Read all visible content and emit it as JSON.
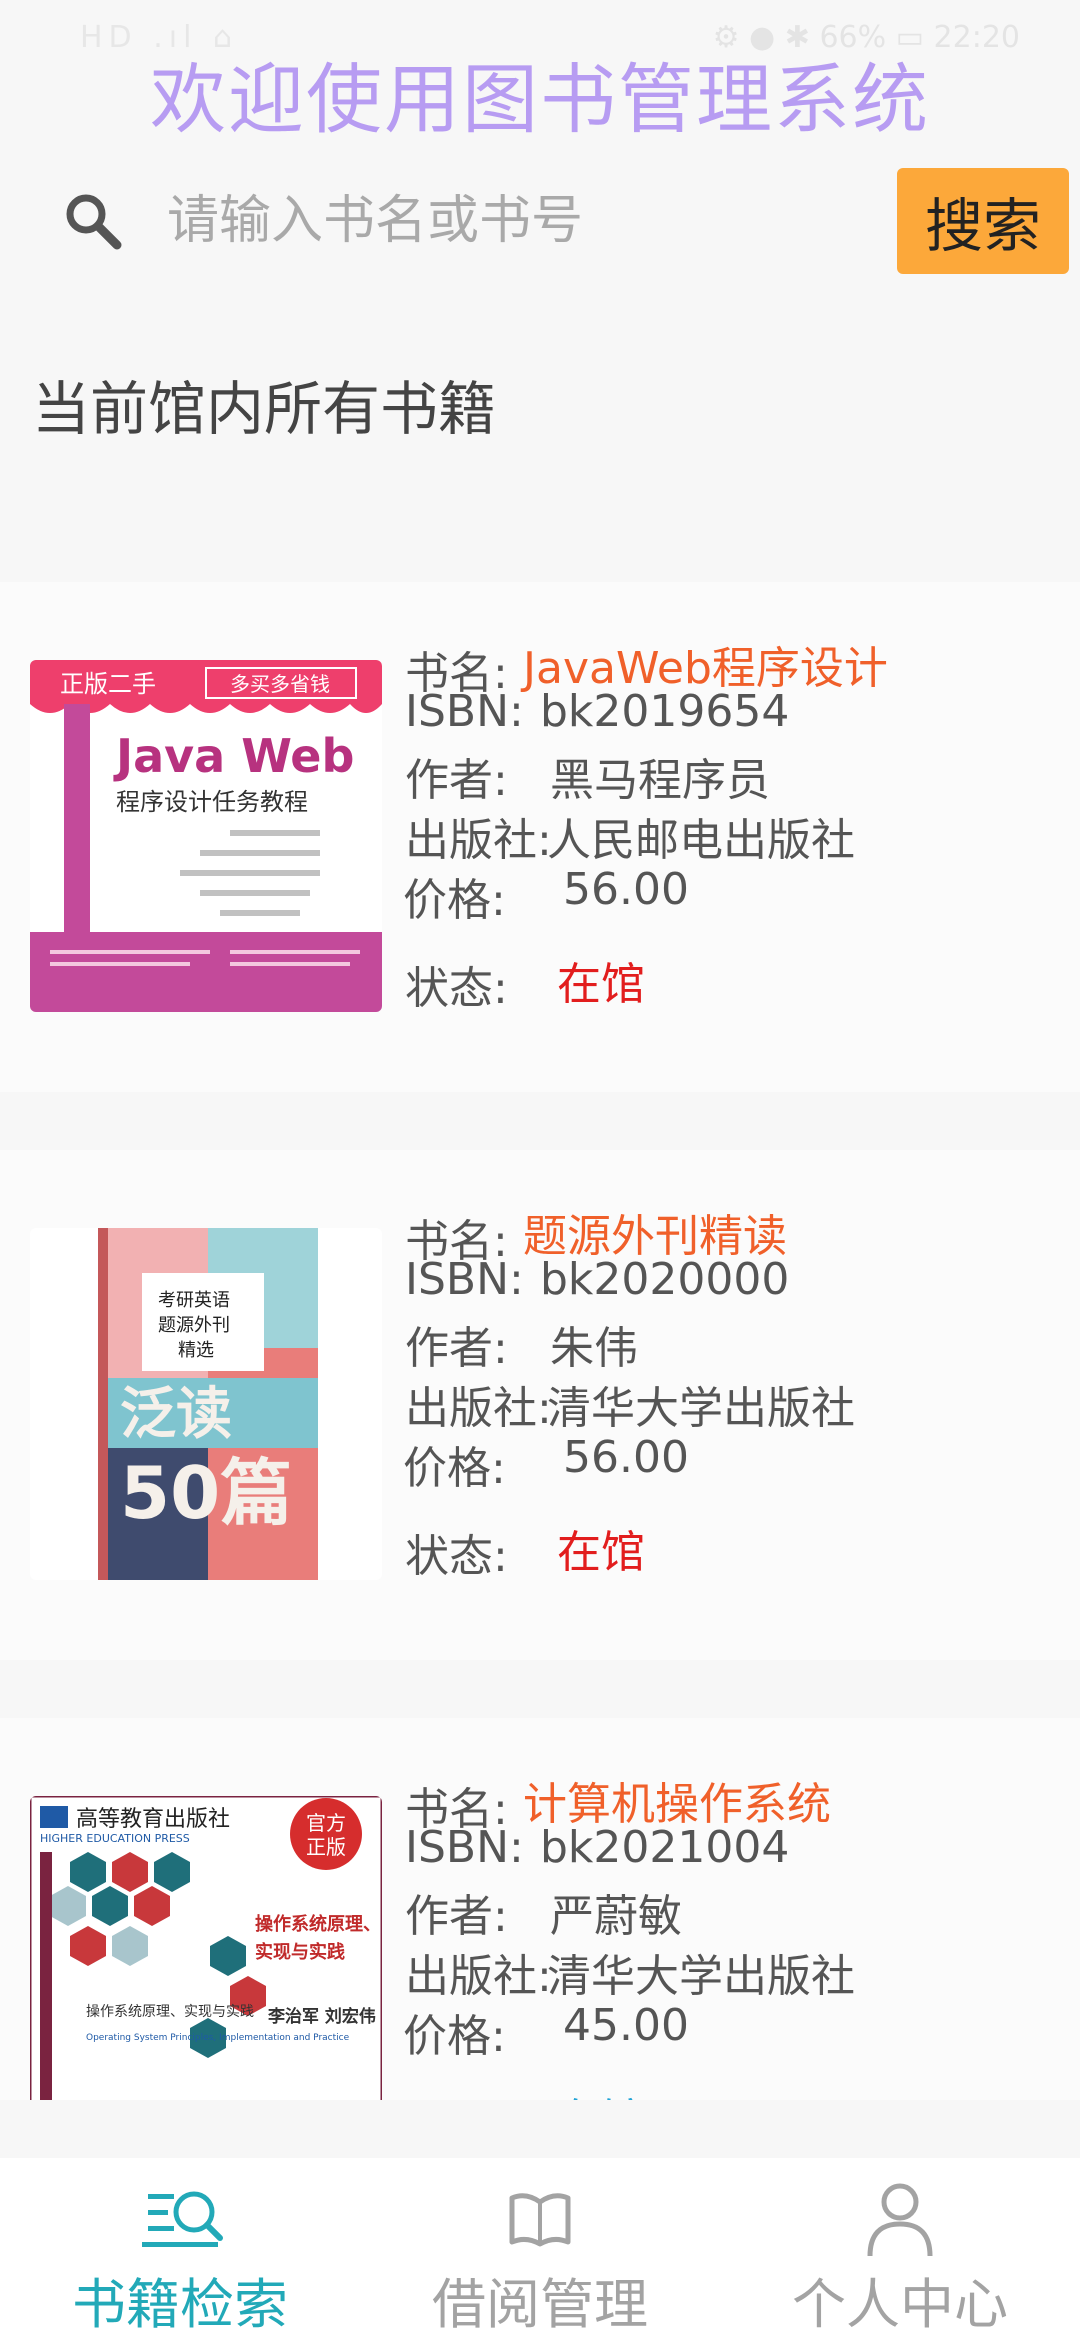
{
  "status_bar": {
    "left": "HD .ıl ⌂",
    "right": "⚙ ● ✱ 66% ▭ 22:20"
  },
  "app_title": "欢迎使用图书管理系统",
  "search": {
    "placeholder": "请输入书名或书号",
    "button_label": "搜索"
  },
  "section_title": "当前馆内所有书籍",
  "labels": {
    "title": "书名:",
    "isbn": "ISBN:",
    "author": "作者:",
    "publisher": "出版社:",
    "price": "价格:",
    "status": "状态:"
  },
  "books": [
    {
      "title": "JavaWeb程序设计",
      "isbn": "bk2019654",
      "author": "黑马程序员",
      "publisher": "人民邮电出版社",
      "price": "56.00",
      "status": "在馆",
      "cover": {
        "banner_left": "正版二手",
        "banner_right": "多买多省钱",
        "heading": "Java Web",
        "subheading": "程序设计任务教程"
      }
    },
    {
      "title": "题源外刊精读",
      "isbn": "bk2020000",
      "author": "朱伟",
      "publisher": "清华大学出版社",
      "price": "56.00",
      "status": "在馆",
      "cover": {
        "box_line1": "考研英语",
        "box_line2": "题源外刊",
        "box_line3": "精选",
        "big_text1": "泛读",
        "big_text2": "50篇"
      }
    },
    {
      "title": "计算机操作系统",
      "isbn": "bk2021004",
      "author": "严蔚敏",
      "publisher": "清华大学出版社",
      "price": "45.00",
      "status": "在馆",
      "cover": {
        "publisher_logo": "高等教育出版社",
        "publisher_en": "HIGHER EDUCATION PRESS",
        "badge_line1": "官方",
        "badge_line2": "正版",
        "heading_line1": "操作系统原理、",
        "heading_line2": "实现与实践",
        "authors": "李治军 刘宏伟",
        "small_title": "操作系统原理、实现与实践",
        "en_title": "Operating System Principles, Implementation and Practice"
      }
    }
  ],
  "tabs": [
    {
      "label": "书籍检索",
      "icon": "book-search-icon",
      "active": true
    },
    {
      "label": "借阅管理",
      "icon": "book-icon",
      "active": false
    },
    {
      "label": "个人中心",
      "icon": "user-icon",
      "active": false
    }
  ],
  "colors": {
    "title": "#b79cf2",
    "search_button": "#fca83a",
    "book_title": "#f0602a",
    "status": "#e21d1d",
    "tab_active": "#22a9b8",
    "tab_inactive": "#a3a3a3"
  }
}
